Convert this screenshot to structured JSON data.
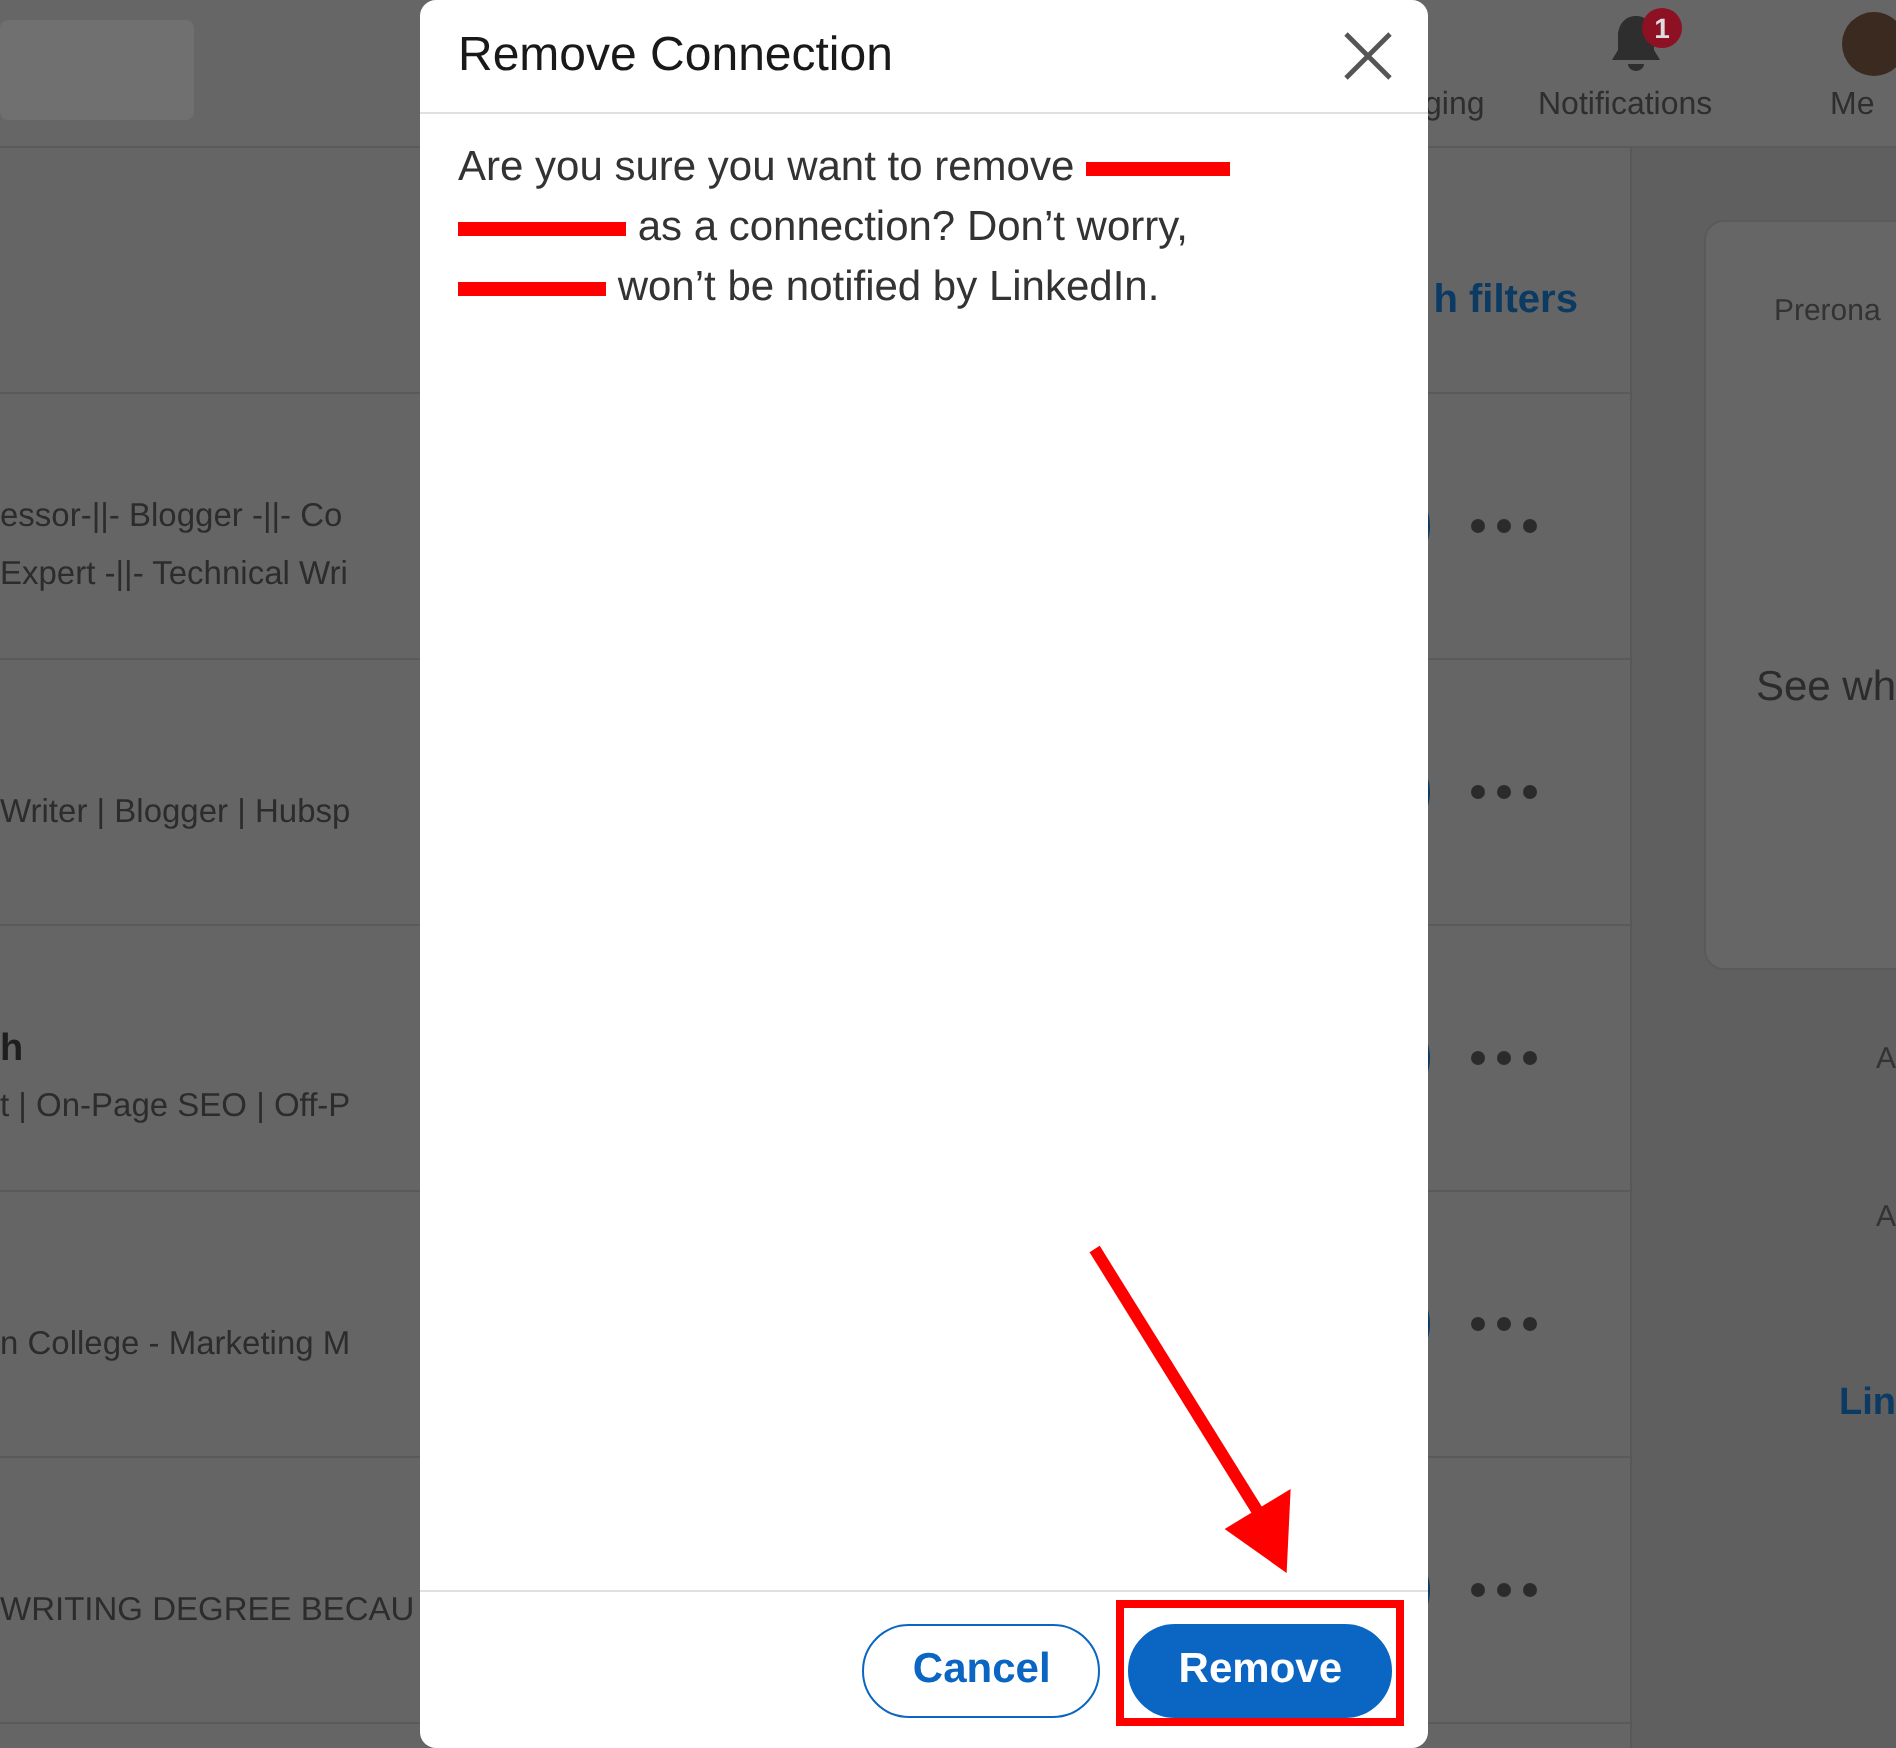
{
  "nav": {
    "items": [
      {
        "kind": "messaging",
        "label": "ging"
      },
      {
        "kind": "notifications",
        "label": "Notifications",
        "badge": "1"
      },
      {
        "kind": "me",
        "label": "Me"
      }
    ]
  },
  "list": {
    "filter_link": "h filters",
    "rows": [
      {
        "lines": [
          {
            "kind": "headline",
            "text": "essor-||- Blogger -||- Co"
          },
          {
            "kind": "headline",
            "text": "Expert -||- Technical Wri"
          }
        ]
      },
      {
        "lines": [
          {
            "kind": "headline",
            "text": "Writer | Blogger | Hubsp"
          }
        ]
      },
      {
        "lines": [
          {
            "kind": "name",
            "text": "h"
          },
          {
            "kind": "headline",
            "text": "t | On-Page SEO | Off-P"
          }
        ]
      },
      {
        "lines": [
          {
            "kind": "headline",
            "text": "n College - Marketing M"
          }
        ]
      },
      {
        "lines": [
          {
            "kind": "headline",
            "text": "WRITING DEGREE BECAU"
          }
        ]
      }
    ]
  },
  "sidebar": {
    "card": {
      "lines": [
        "Prerona",
        "See wh"
      ]
    },
    "items": [
      {
        "kind": "text",
        "text": "A"
      },
      {
        "kind": "text",
        "text": "A"
      },
      {
        "kind": "link",
        "text": "Lin"
      }
    ]
  },
  "dialog": {
    "title": "Remove Connection",
    "message": [
      {
        "kind": "text",
        "text": "Are you sure you want to remove "
      },
      {
        "kind": "redaction"
      },
      {
        "kind": "redaction"
      },
      {
        "kind": "text",
        "text": " as a connection? Don’t worry, "
      },
      {
        "kind": "redaction"
      },
      {
        "kind": "text",
        "text": " won’t be notified by LinkedIn."
      }
    ],
    "buttons": [
      {
        "kind": "secondary",
        "label": "Cancel",
        "highlighted": false
      },
      {
        "kind": "primary",
        "label": "Remove",
        "highlighted": true
      }
    ]
  }
}
